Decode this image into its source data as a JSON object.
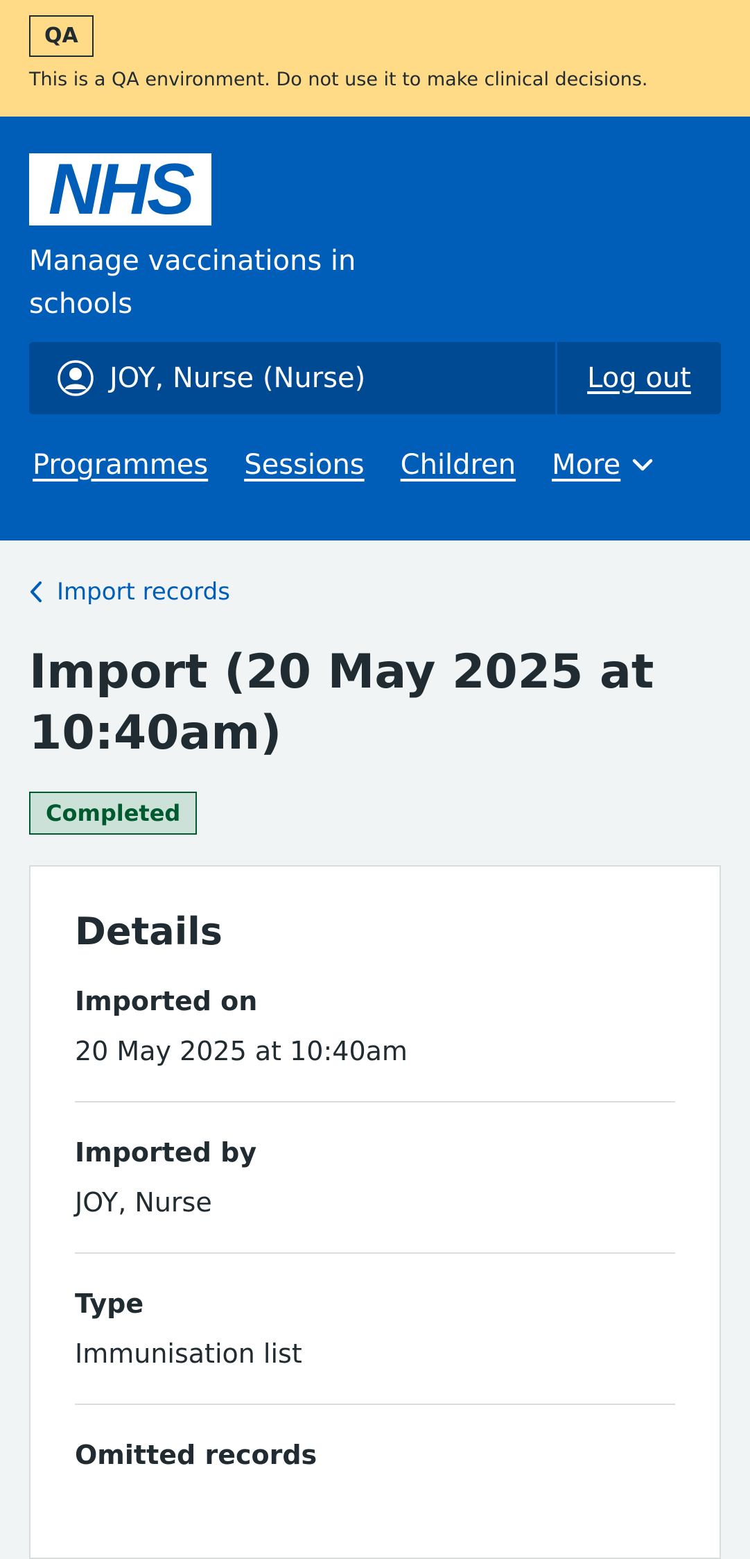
{
  "qa_banner": {
    "tag": "QA",
    "message": "This is a QA environment. Do not use it to make clinical decisions."
  },
  "header": {
    "logo_text": "NHS",
    "service_name": "Manage vaccinations in schools",
    "account": {
      "user": "JOY, Nurse (Nurse)",
      "icon": "user-circle-icon",
      "logout_label": "Log out"
    },
    "nav": {
      "items": [
        "Programmes",
        "Sessions",
        "Children"
      ],
      "more_label": "More"
    }
  },
  "main": {
    "back_link": "Import records",
    "title": "Import (20 May 2025 at 10:40am)",
    "status": "Completed",
    "details": {
      "heading": "Details",
      "rows": [
        {
          "key": "Imported on",
          "value": "20 May 2025 at 10:40am"
        },
        {
          "key": "Imported by",
          "value": "JOY, Nurse"
        },
        {
          "key": "Type",
          "value": "Immunisation list"
        },
        {
          "key": "Omitted records",
          "value": ""
        }
      ]
    }
  },
  "colors": {
    "nhs_blue": "#005eb8",
    "qa_yellow": "#ffdb87",
    "status_green": "#005a30"
  }
}
